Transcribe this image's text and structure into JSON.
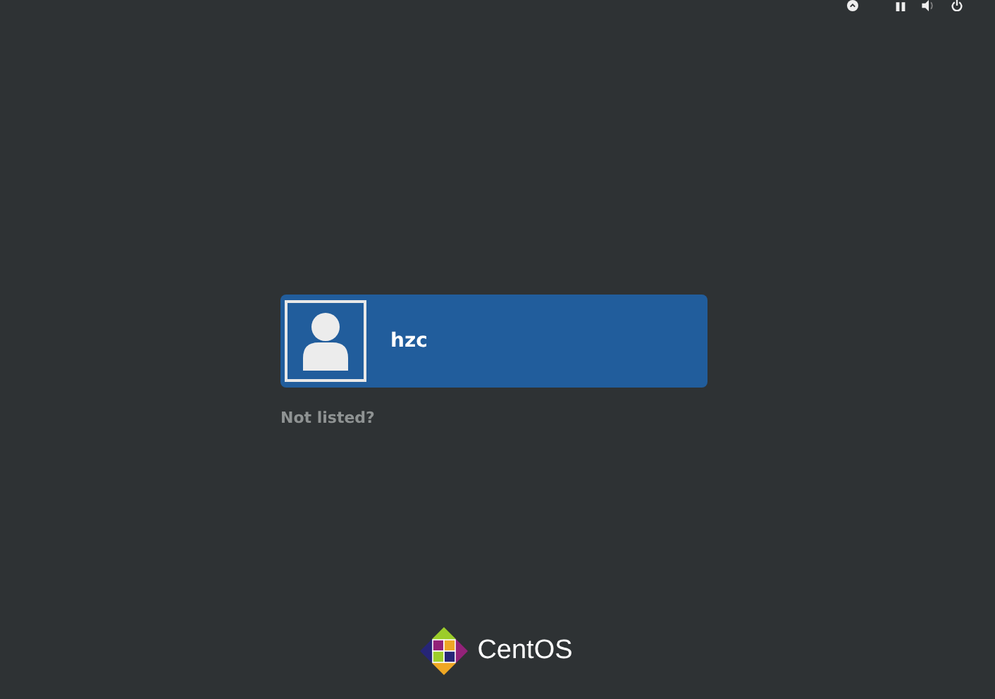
{
  "users": [
    {
      "name": "hzc",
      "selected": true
    }
  ],
  "not_listed_link": "Not listed?",
  "logo_text": "CentOS"
}
